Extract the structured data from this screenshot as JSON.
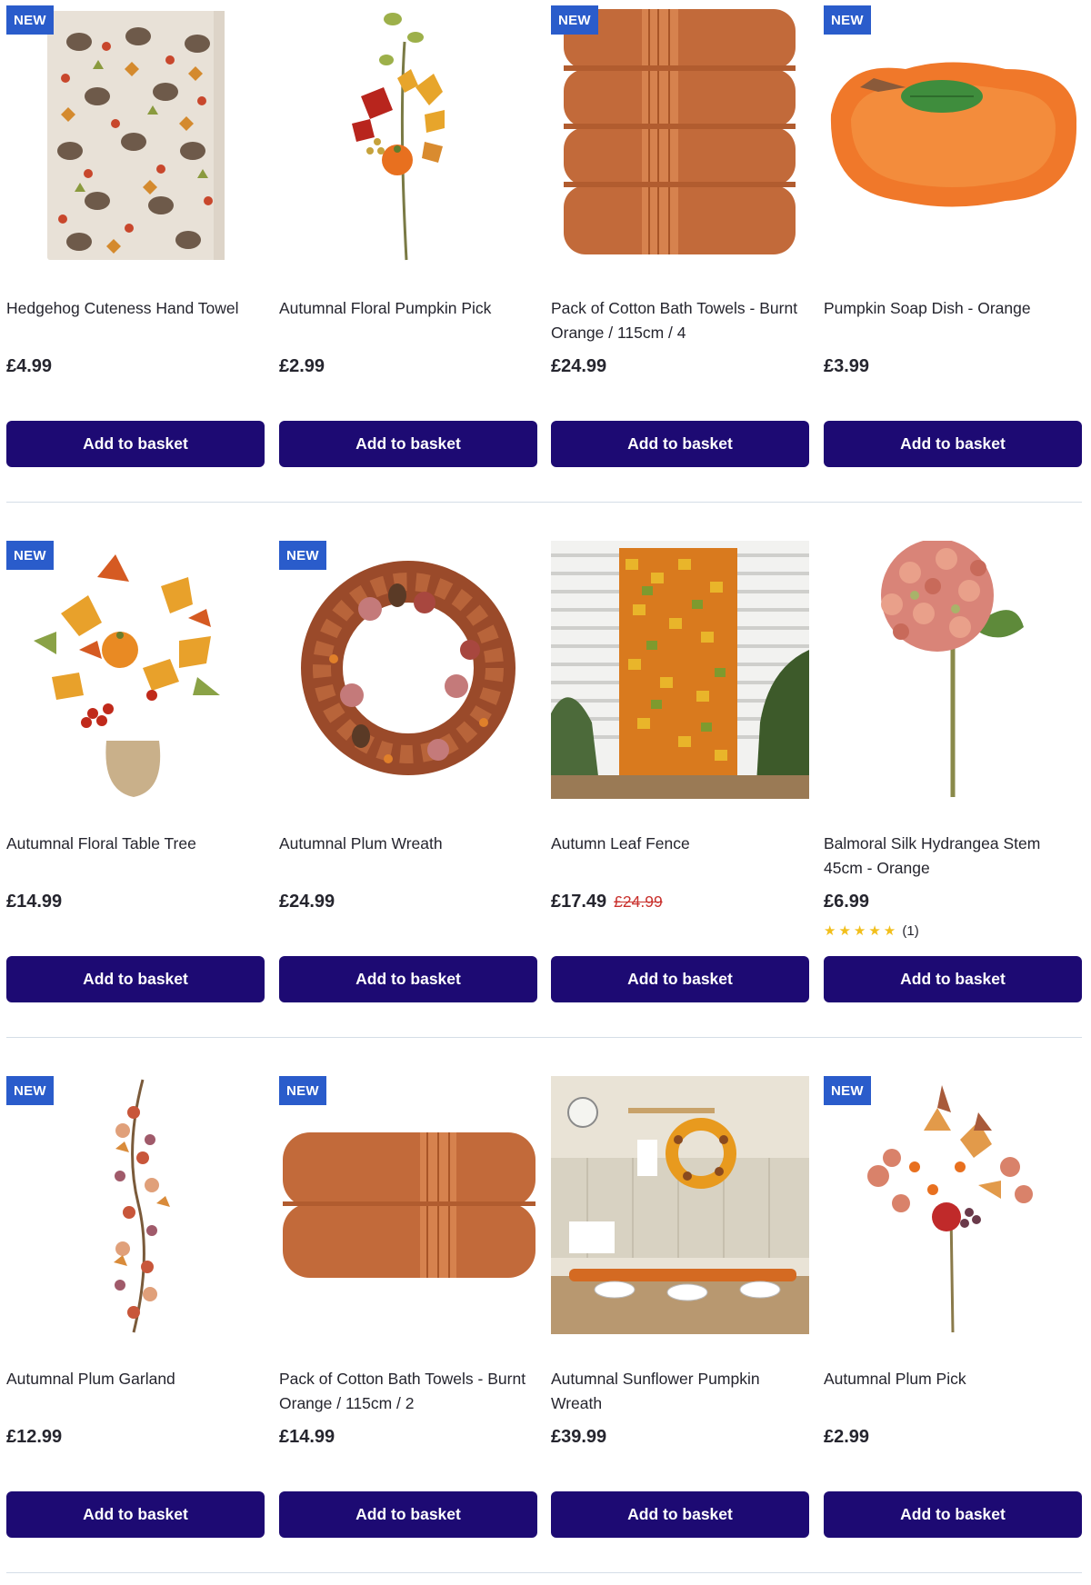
{
  "button_label": "Add to basket",
  "badge_label": "NEW",
  "colors": {
    "button_bg": "#1d0a73",
    "badge_bg": "#2a5ccb",
    "sale_price": "#c9302c",
    "star": "#f2bf1b"
  },
  "rows": [
    {
      "products": [
        {
          "title": "Hedgehog Cuteness Hand Towel",
          "price": "£4.99",
          "badge": true,
          "image": "hedgehog-towel-image"
        },
        {
          "title": "Autumnal Floral Pumpkin Pick",
          "price": "£2.99",
          "badge": false,
          "image": "floral-pumpkin-pick-image"
        },
        {
          "title": "Pack of Cotton Bath Towels - Burnt Orange / 115cm / 4",
          "price": "£24.99",
          "badge": true,
          "image": "towel-stack-4-image"
        },
        {
          "title": "Pumpkin Soap Dish - Orange",
          "price": "£3.99",
          "badge": true,
          "image": "pumpkin-soap-dish-image"
        }
      ]
    },
    {
      "products": [
        {
          "title": "Autumnal Floral Table Tree",
          "price": "£14.99",
          "badge": true,
          "image": "floral-table-tree-image"
        },
        {
          "title": "Autumnal Plum Wreath",
          "price": "£24.99",
          "badge": true,
          "image": "plum-wreath-image"
        },
        {
          "title": "Autumn Leaf Fence",
          "price": "£17.49",
          "was_price": "£24.99",
          "badge": false,
          "image": "leaf-fence-image"
        },
        {
          "title": "Balmoral Silk Hydrangea Stem 45cm - Orange",
          "price": "£6.99",
          "badge": false,
          "image": "hydrangea-stem-image",
          "rating": {
            "stars": "★★★★★",
            "count": "(1)",
            "value": 5
          }
        }
      ]
    },
    {
      "products": [
        {
          "title": "Autumnal Plum Garland",
          "price": "£12.99",
          "badge": true,
          "image": "plum-garland-image"
        },
        {
          "title": "Pack of Cotton Bath Towels - Burnt Orange / 115cm / 2",
          "price": "£14.99",
          "badge": true,
          "image": "towel-stack-2-image"
        },
        {
          "title": "Autumnal Sunflower Pumpkin Wreath",
          "price": "£39.99",
          "badge": false,
          "image": "sunflower-wreath-scene-image"
        },
        {
          "title": "Autumnal Plum Pick",
          "price": "£2.99",
          "badge": true,
          "image": "plum-pick-image"
        }
      ]
    }
  ]
}
